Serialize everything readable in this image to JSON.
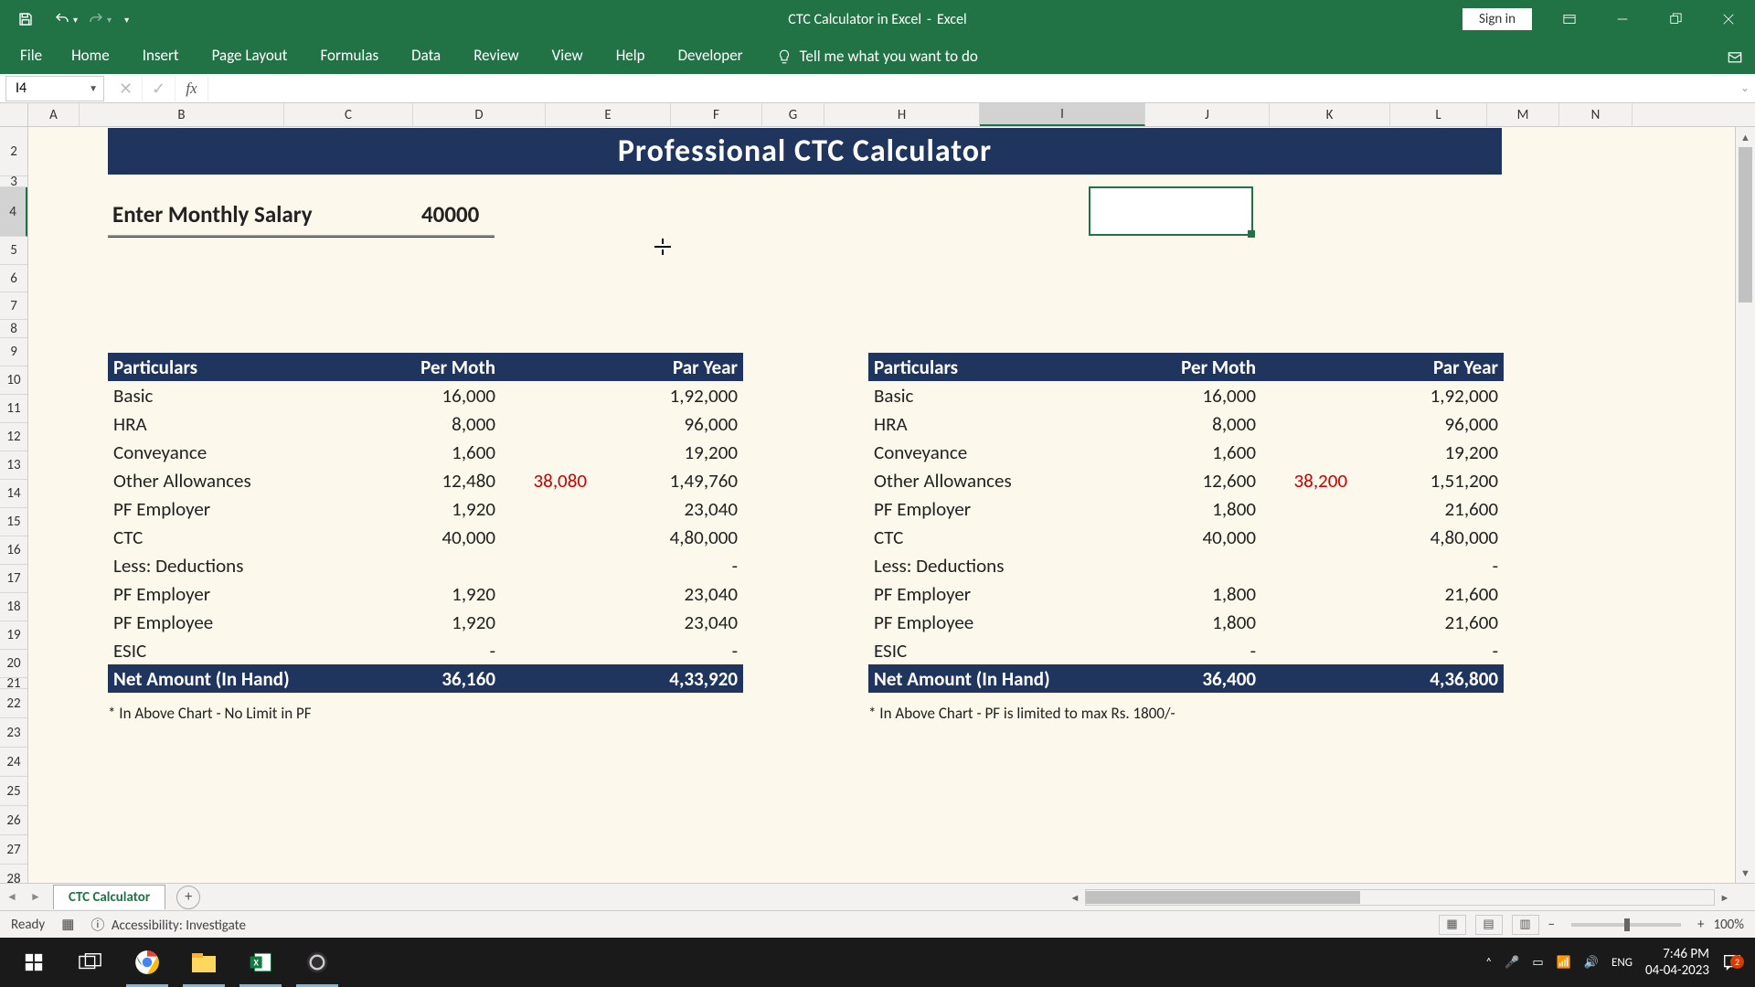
{
  "title": {
    "doc": "CTC Calculator in Excel",
    "app": "Excel"
  },
  "signin": "Sign in",
  "ribbon_tabs": [
    "File",
    "Home",
    "Insert",
    "Page Layout",
    "Formulas",
    "Data",
    "Review",
    "View",
    "Help",
    "Developer"
  ],
  "tellme": "Tell me what you want to do",
  "namebox": "I4",
  "formula": "",
  "col_letters": [
    "A",
    "B",
    "C",
    "D",
    "E",
    "F",
    "G",
    "H",
    "I",
    "J",
    "K",
    "L",
    "M",
    "N"
  ],
  "row_nums": [
    "2",
    "3",
    "4",
    "5",
    "6",
    "7",
    "8",
    "9",
    "10",
    "11",
    "12",
    "13",
    "14",
    "15",
    "16",
    "17",
    "18",
    "19",
    "20",
    "21",
    "22",
    "23",
    "24",
    "25",
    "26",
    "27",
    "28"
  ],
  "banner": "Professional CTC Calculator",
  "enter_label": "Enter Monthly Salary",
  "enter_value": "40000",
  "table_headers": {
    "p": "Particulars",
    "pm": "Per Moth",
    "py": "Par Year"
  },
  "rows_labels": {
    "basic": "Basic",
    "hra": "HRA",
    "conv": "Conveyance",
    "other": "Other Allowances",
    "pfemp": "PF Employer",
    "ctc": "CTC",
    "less": "Less: Deductions",
    "pfemp2": "PF Employer",
    "pfempl": "PF Employee",
    "esic": "ESIC",
    "net": "Net Amount (In Hand)"
  },
  "t1": {
    "basic": {
      "pm": "16,000",
      "py": "1,92,000"
    },
    "hra": {
      "pm": "8,000",
      "py": "96,000"
    },
    "conv": {
      "pm": "1,600",
      "py": "19,200"
    },
    "other": {
      "pm": "12,480",
      "py": "1,49,760",
      "mid": "38,080"
    },
    "pfemp": {
      "pm": "1,920",
      "py": "23,040"
    },
    "ctc": {
      "pm": "40,000",
      "py": "4,80,000"
    },
    "less": {
      "pm": "",
      "py": "-"
    },
    "pfemp2": {
      "pm": "1,920",
      "py": "23,040"
    },
    "pfempl": {
      "pm": "1,920",
      "py": "23,040"
    },
    "esic": {
      "pm": "-",
      "py": "-"
    },
    "net": {
      "pm": "36,160",
      "py": "4,33,920"
    },
    "note": "* In Above Chart - No Limit in PF"
  },
  "t2": {
    "basic": {
      "pm": "16,000",
      "py": "1,92,000"
    },
    "hra": {
      "pm": "8,000",
      "py": "96,000"
    },
    "conv": {
      "pm": "1,600",
      "py": "19,200"
    },
    "other": {
      "pm": "12,600",
      "py": "1,51,200",
      "mid": "38,200"
    },
    "pfemp": {
      "pm": "1,800",
      "py": "21,600"
    },
    "ctc": {
      "pm": "40,000",
      "py": "4,80,000"
    },
    "less": {
      "pm": "",
      "py": "-"
    },
    "pfemp2": {
      "pm": "1,800",
      "py": "21,600"
    },
    "pfempl": {
      "pm": "1,800",
      "py": "21,600"
    },
    "esic": {
      "pm": "-",
      "py": "-"
    },
    "net": {
      "pm": "36,400",
      "py": "4,36,800"
    },
    "note": "* In Above Chart - PF is limited to max Rs. 1800/-"
  },
  "sheet_tab": "CTC Calculator",
  "status": {
    "ready": "Ready",
    "access": "Accessibility: Investigate",
    "zoom": "100%"
  },
  "tray": {
    "lang": "ENG",
    "time": "7:46 PM",
    "date": "04-04-2023",
    "notif_count": "2"
  }
}
